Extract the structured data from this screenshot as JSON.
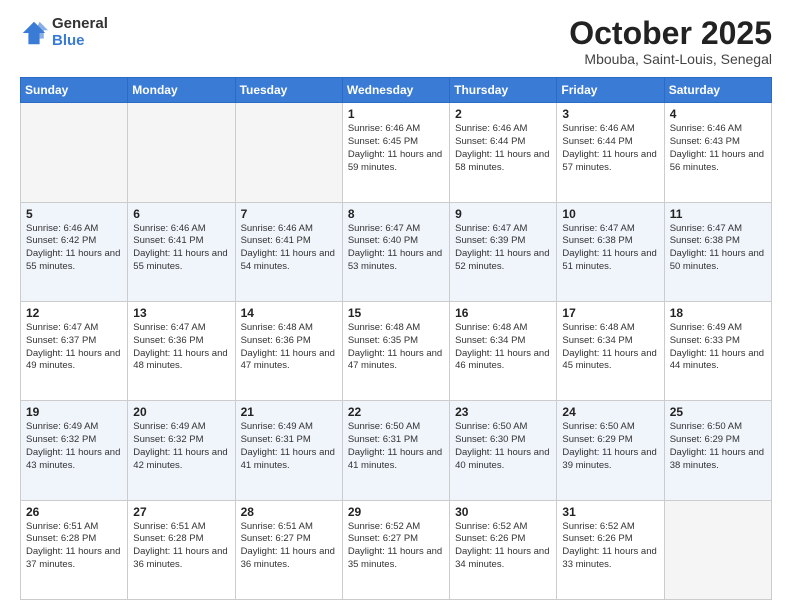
{
  "logo": {
    "general": "General",
    "blue": "Blue"
  },
  "title": {
    "month": "October 2025",
    "location": "Mbouba, Saint-Louis, Senegal"
  },
  "weekdays": [
    "Sunday",
    "Monday",
    "Tuesday",
    "Wednesday",
    "Thursday",
    "Friday",
    "Saturday"
  ],
  "weeks": [
    [
      {
        "day": "",
        "info": ""
      },
      {
        "day": "",
        "info": ""
      },
      {
        "day": "",
        "info": ""
      },
      {
        "day": "1",
        "info": "Sunrise: 6:46 AM\nSunset: 6:45 PM\nDaylight: 11 hours and 59 minutes."
      },
      {
        "day": "2",
        "info": "Sunrise: 6:46 AM\nSunset: 6:44 PM\nDaylight: 11 hours and 58 minutes."
      },
      {
        "day": "3",
        "info": "Sunrise: 6:46 AM\nSunset: 6:44 PM\nDaylight: 11 hours and 57 minutes."
      },
      {
        "day": "4",
        "info": "Sunrise: 6:46 AM\nSunset: 6:43 PM\nDaylight: 11 hours and 56 minutes."
      }
    ],
    [
      {
        "day": "5",
        "info": "Sunrise: 6:46 AM\nSunset: 6:42 PM\nDaylight: 11 hours and 55 minutes."
      },
      {
        "day": "6",
        "info": "Sunrise: 6:46 AM\nSunset: 6:41 PM\nDaylight: 11 hours and 55 minutes."
      },
      {
        "day": "7",
        "info": "Sunrise: 6:46 AM\nSunset: 6:41 PM\nDaylight: 11 hours and 54 minutes."
      },
      {
        "day": "8",
        "info": "Sunrise: 6:47 AM\nSunset: 6:40 PM\nDaylight: 11 hours and 53 minutes."
      },
      {
        "day": "9",
        "info": "Sunrise: 6:47 AM\nSunset: 6:39 PM\nDaylight: 11 hours and 52 minutes."
      },
      {
        "day": "10",
        "info": "Sunrise: 6:47 AM\nSunset: 6:38 PM\nDaylight: 11 hours and 51 minutes."
      },
      {
        "day": "11",
        "info": "Sunrise: 6:47 AM\nSunset: 6:38 PM\nDaylight: 11 hours and 50 minutes."
      }
    ],
    [
      {
        "day": "12",
        "info": "Sunrise: 6:47 AM\nSunset: 6:37 PM\nDaylight: 11 hours and 49 minutes."
      },
      {
        "day": "13",
        "info": "Sunrise: 6:47 AM\nSunset: 6:36 PM\nDaylight: 11 hours and 48 minutes."
      },
      {
        "day": "14",
        "info": "Sunrise: 6:48 AM\nSunset: 6:36 PM\nDaylight: 11 hours and 47 minutes."
      },
      {
        "day": "15",
        "info": "Sunrise: 6:48 AM\nSunset: 6:35 PM\nDaylight: 11 hours and 47 minutes."
      },
      {
        "day": "16",
        "info": "Sunrise: 6:48 AM\nSunset: 6:34 PM\nDaylight: 11 hours and 46 minutes."
      },
      {
        "day": "17",
        "info": "Sunrise: 6:48 AM\nSunset: 6:34 PM\nDaylight: 11 hours and 45 minutes."
      },
      {
        "day": "18",
        "info": "Sunrise: 6:49 AM\nSunset: 6:33 PM\nDaylight: 11 hours and 44 minutes."
      }
    ],
    [
      {
        "day": "19",
        "info": "Sunrise: 6:49 AM\nSunset: 6:32 PM\nDaylight: 11 hours and 43 minutes."
      },
      {
        "day": "20",
        "info": "Sunrise: 6:49 AM\nSunset: 6:32 PM\nDaylight: 11 hours and 42 minutes."
      },
      {
        "day": "21",
        "info": "Sunrise: 6:49 AM\nSunset: 6:31 PM\nDaylight: 11 hours and 41 minutes."
      },
      {
        "day": "22",
        "info": "Sunrise: 6:50 AM\nSunset: 6:31 PM\nDaylight: 11 hours and 41 minutes."
      },
      {
        "day": "23",
        "info": "Sunrise: 6:50 AM\nSunset: 6:30 PM\nDaylight: 11 hours and 40 minutes."
      },
      {
        "day": "24",
        "info": "Sunrise: 6:50 AM\nSunset: 6:29 PM\nDaylight: 11 hours and 39 minutes."
      },
      {
        "day": "25",
        "info": "Sunrise: 6:50 AM\nSunset: 6:29 PM\nDaylight: 11 hours and 38 minutes."
      }
    ],
    [
      {
        "day": "26",
        "info": "Sunrise: 6:51 AM\nSunset: 6:28 PM\nDaylight: 11 hours and 37 minutes."
      },
      {
        "day": "27",
        "info": "Sunrise: 6:51 AM\nSunset: 6:28 PM\nDaylight: 11 hours and 36 minutes."
      },
      {
        "day": "28",
        "info": "Sunrise: 6:51 AM\nSunset: 6:27 PM\nDaylight: 11 hours and 36 minutes."
      },
      {
        "day": "29",
        "info": "Sunrise: 6:52 AM\nSunset: 6:27 PM\nDaylight: 11 hours and 35 minutes."
      },
      {
        "day": "30",
        "info": "Sunrise: 6:52 AM\nSunset: 6:26 PM\nDaylight: 11 hours and 34 minutes."
      },
      {
        "day": "31",
        "info": "Sunrise: 6:52 AM\nSunset: 6:26 PM\nDaylight: 11 hours and 33 minutes."
      },
      {
        "day": "",
        "info": ""
      }
    ]
  ]
}
